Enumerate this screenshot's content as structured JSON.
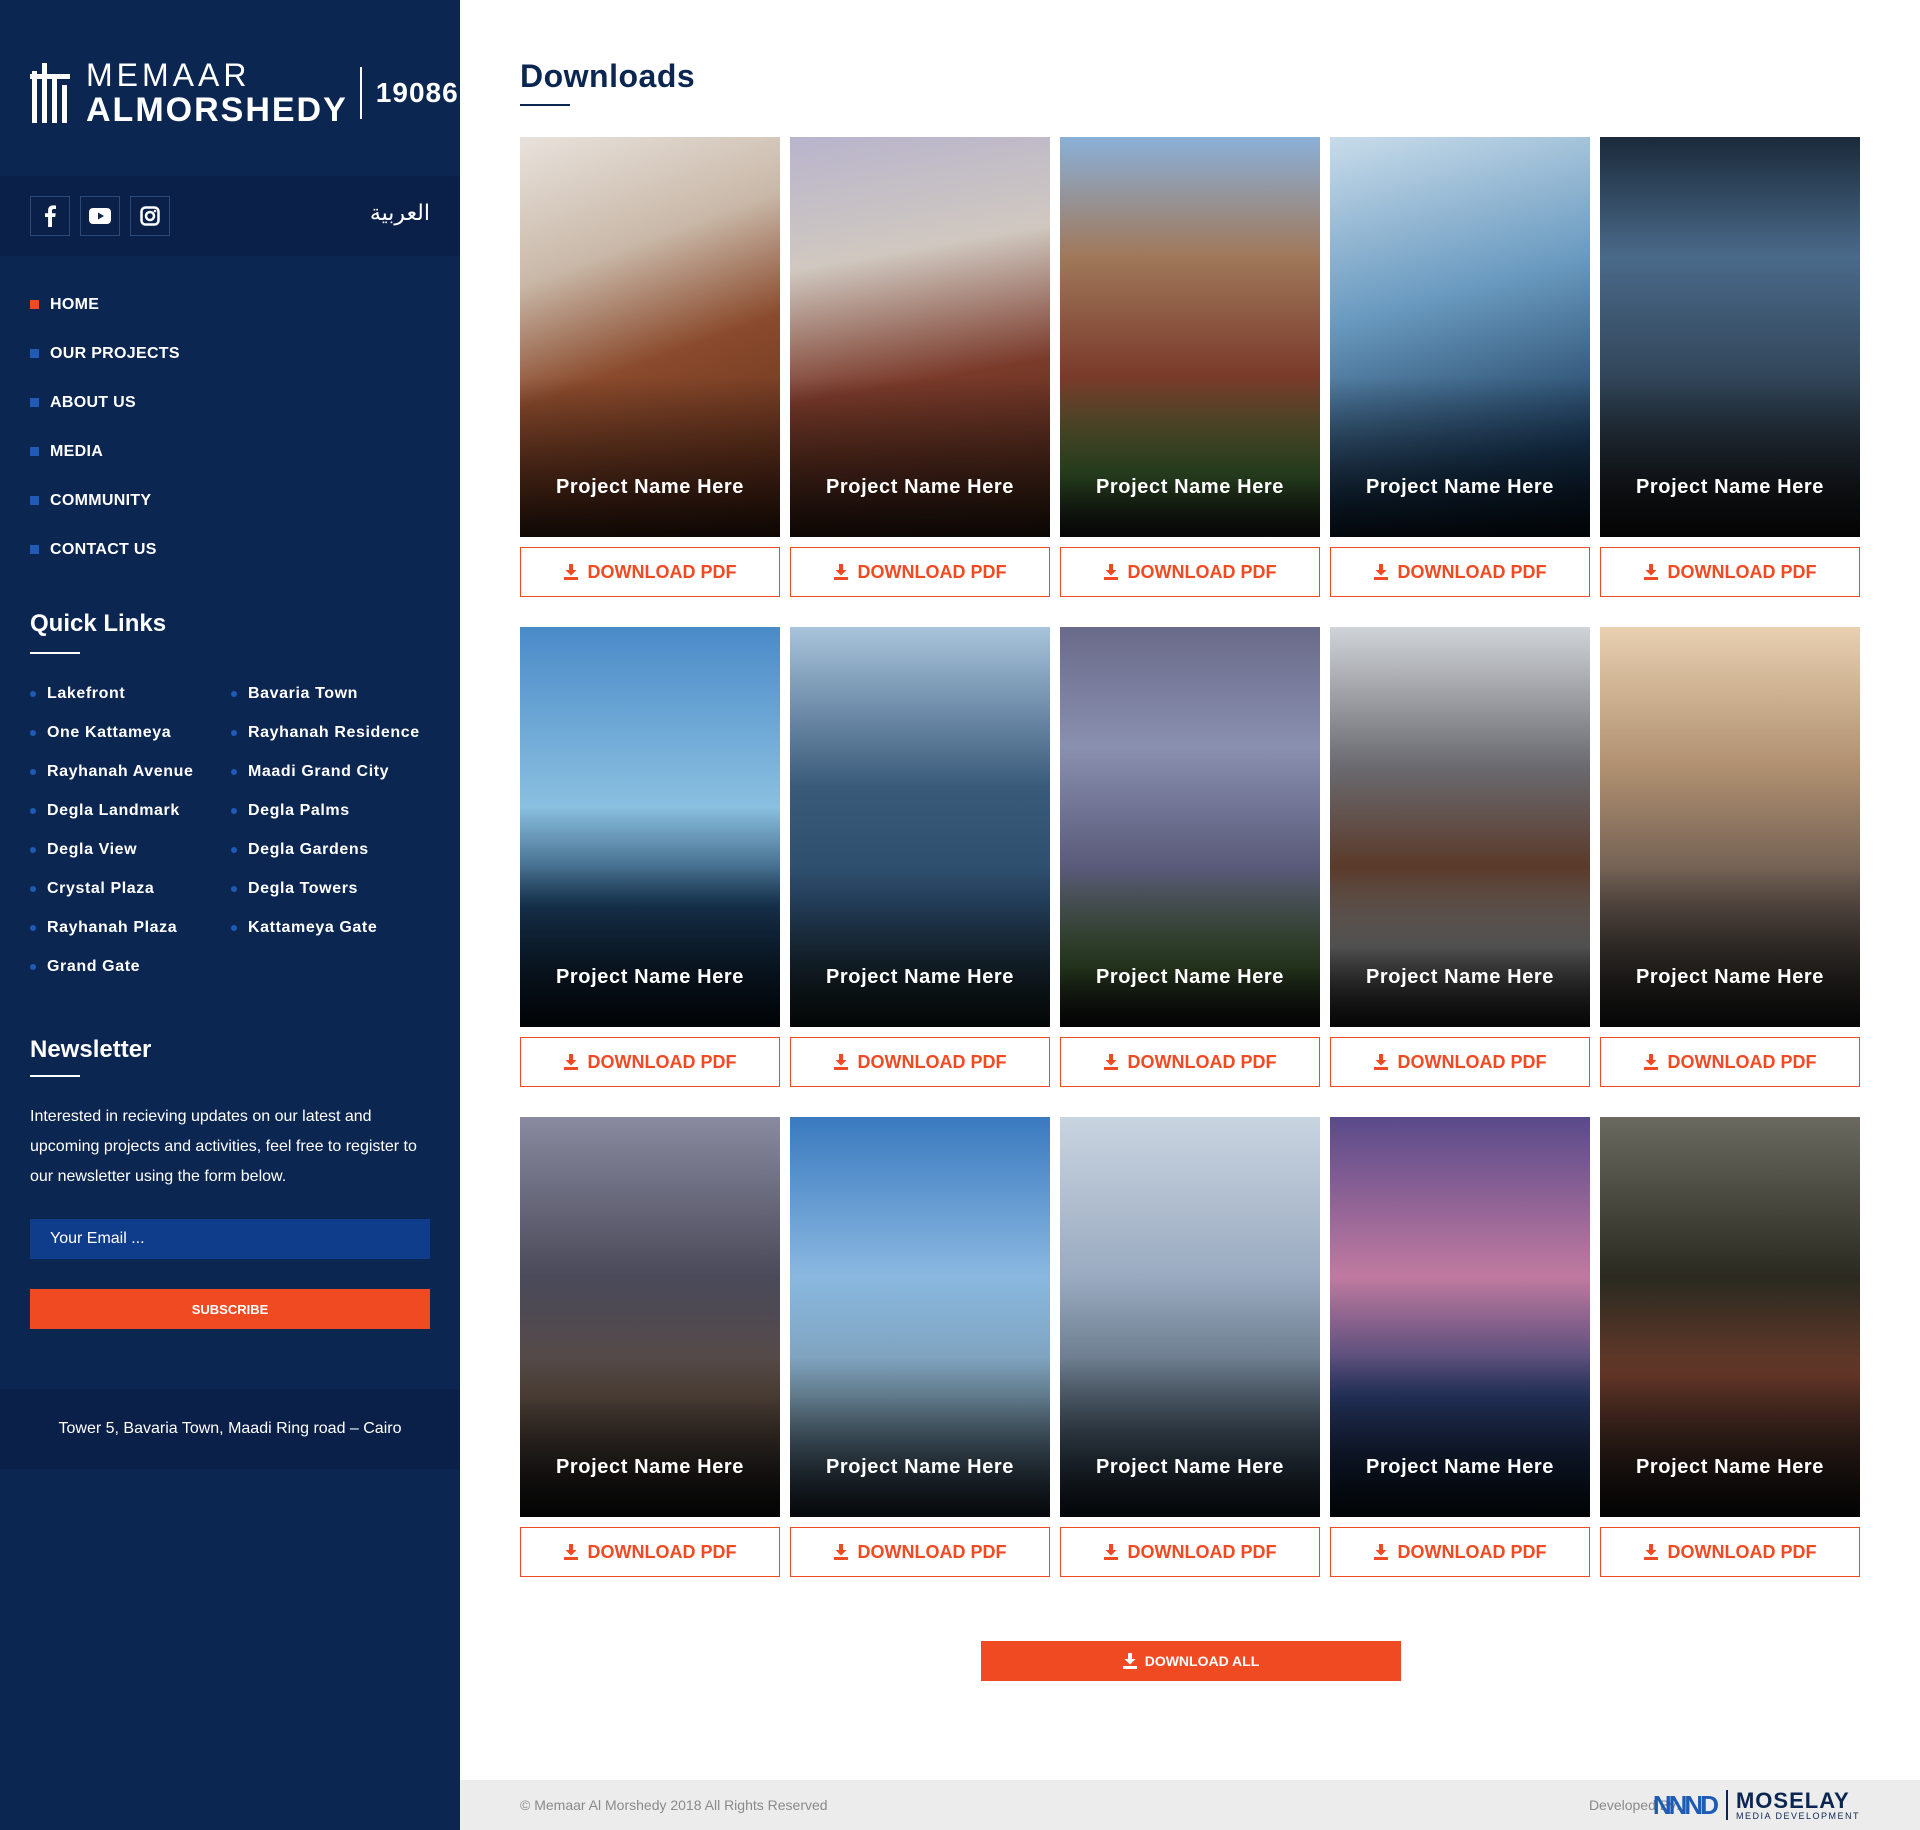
{
  "brand": {
    "line1": "MEMAAR",
    "line2": "ALMORSHEDY",
    "hotline": "19086"
  },
  "social": {
    "icons": [
      "facebook-icon",
      "youtube-icon",
      "instagram-icon"
    ],
    "language_link": "العربية"
  },
  "nav": {
    "items": [
      "HOME",
      "OUR PROJECTS",
      "ABOUT US",
      "MEDIA",
      "COMMUNITY",
      "CONTACT US"
    ],
    "active_index": 0
  },
  "quick_links": {
    "title": "Quick Links",
    "col1": [
      "Lakefront",
      "One Kattameya",
      "Rayhanah Avenue",
      "Degla Landmark",
      "Degla View",
      "Crystal Plaza",
      "Rayhanah Plaza",
      "Grand Gate"
    ],
    "col2": [
      "Bavaria Town",
      "Rayhanah Residence",
      "Maadi Grand City",
      "Degla Palms",
      "Degla Gardens",
      "Degla Towers",
      "Kattameya Gate"
    ]
  },
  "newsletter": {
    "title": "Newsletter",
    "text": "Interested in recieving updates on our latest and upcoming projects and activities, feel free to register to our newsletter using the form below.",
    "placeholder": "Your Email ...",
    "button": "SUBSCRIBE"
  },
  "address": "Tower 5,  Bavaria Town, Maadi Ring road – Cairo",
  "main": {
    "title": "Downloads",
    "download_label": "DOWNLOAD PDF",
    "download_all": "DOWNLOAD ALL",
    "projects": [
      "Project Name Here",
      "Project Name Here",
      "Project Name Here",
      "Project Name Here",
      "Project Name Here",
      "Project Name Here",
      "Project Name Here",
      "Project Name Here",
      "Project Name Here",
      "Project Name Here",
      "Project Name Here",
      "Project Name Here",
      "Project Name Here",
      "Project Name Here",
      "Project Name Here"
    ]
  },
  "footer": {
    "copyright": "© Memaar Al Morshedy 2018 All Rights Reserved",
    "developed_by": "Developed By:",
    "developer_name": "MOSELAY",
    "developer_sub": "MEDIA DEVELOPMENT"
  },
  "colors": {
    "sidebar": "#0c2652",
    "accent": "#f04a23",
    "nav_bullet": "#1e5bb5"
  }
}
